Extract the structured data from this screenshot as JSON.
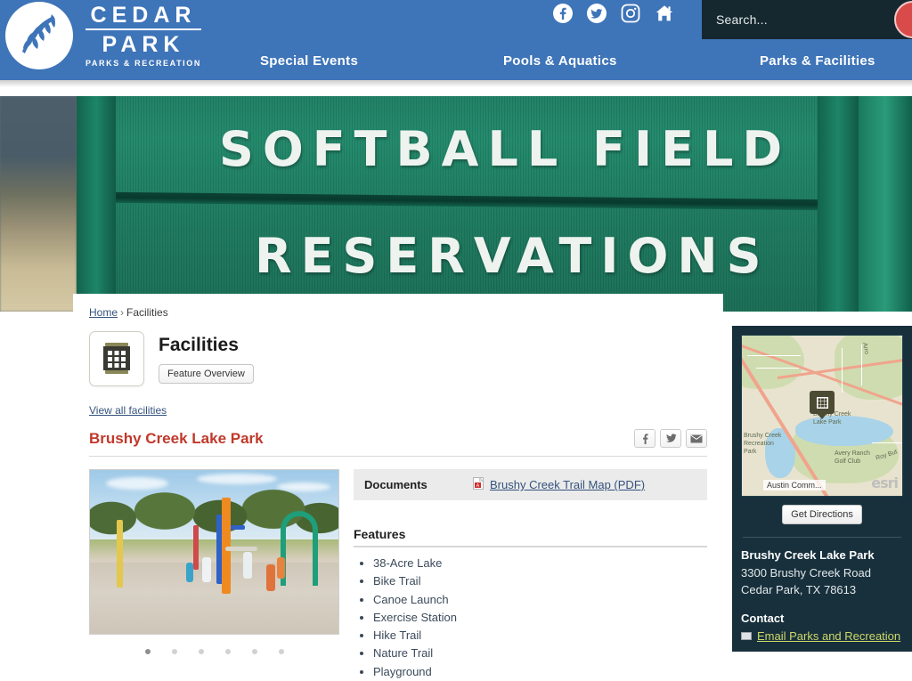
{
  "header": {
    "logo": {
      "line1": "CEDAR",
      "line2": "PARK",
      "sub": "PARKS & RECREATION",
      "mark": "leaf-circle-logo"
    },
    "social": [
      {
        "name": "facebook-icon",
        "label": "Facebook"
      },
      {
        "name": "twitter-icon",
        "label": "Twitter"
      },
      {
        "name": "instagram-icon",
        "label": "Instagram"
      },
      {
        "name": "home-icon",
        "label": "Home"
      }
    ],
    "search": {
      "placeholder": "Search...",
      "value": "",
      "button": "search-icon",
      "button_color": "#d94a4a",
      "box_color": "#16282f"
    },
    "nav": [
      {
        "label": "Special Events"
      },
      {
        "label": "Pools & Aquatics"
      },
      {
        "label": "Parks & Facilities"
      }
    ],
    "bg_color": "#3e74b8"
  },
  "hero": {
    "sign_line1": "SOFTBALL FIELD",
    "sign_line2": "RESERVATIONS",
    "alt": "green wooden softball field reservations sign"
  },
  "breadcrumb": {
    "home": "Home",
    "separator": "›",
    "current": "Facilities"
  },
  "facility_header": {
    "icon": "facilities-building-icon",
    "title": "Facilities",
    "button": "Feature Overview",
    "view_all": "View all facilities"
  },
  "park": {
    "title": "Brushy Creek Lake Park",
    "title_color": "#c0392b",
    "share": [
      {
        "name": "share-facebook-icon",
        "glyph": "f"
      },
      {
        "name": "share-twitter-icon",
        "glyph": "t"
      },
      {
        "name": "share-email-icon",
        "glyph": "e"
      }
    ]
  },
  "carousel": {
    "alt": "splash pad with children playing",
    "dots": 6,
    "active_dot": 0
  },
  "documents": {
    "label": "Documents",
    "icon": "pdf-icon",
    "link": "Brushy Creek Trail Map (PDF)"
  },
  "features": {
    "heading": "Features",
    "items": [
      "38-Acre Lake",
      "Bike Trail",
      "Canoe Launch",
      "Exercise Station",
      "Hike Trail",
      "Nature Trail",
      "Playground"
    ]
  },
  "sidebar": {
    "map": {
      "labels": [
        "Brushy Creek Lake Park",
        "Brushy Creek Recreation Park",
        "Avery Ranch Golf Club",
        "Arro",
        "Roy But"
      ],
      "attribution_label": "Austin Comm...",
      "watermark": "esri",
      "pin": "facility-map-pin"
    },
    "get_directions": "Get Directions",
    "name": "Brushy Creek Lake Park",
    "address_line1": "3300 Brushy Creek Road",
    "address_line2": "Cedar Park, TX 78613",
    "contact_heading": "Contact",
    "contact_email": "Email Parks and Recreation",
    "bg_color": "#17303c"
  }
}
